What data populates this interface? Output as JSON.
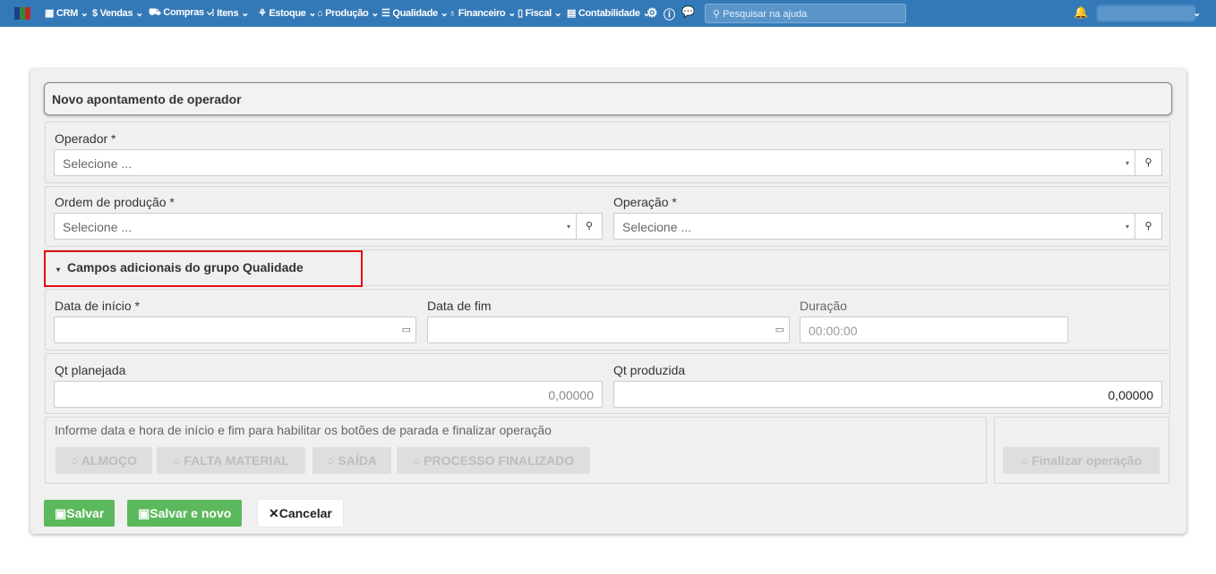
{
  "nav": {
    "items": [
      "CRM",
      "Vendas",
      "Compras",
      "Itens",
      "Estoque",
      "Produção",
      "Qualidade",
      "Financeiro",
      "Fiscal",
      "Contabilidade"
    ],
    "search_placeholder": "Pesquisar na ajuda",
    "brand_colors": [
      "#1c3e8c",
      "#2e8b3a",
      "#c0272d",
      "#e3a21a"
    ]
  },
  "form": {
    "title": "Novo apontamento de operador",
    "operador": {
      "label": "Operador *",
      "placeholder": "Selecione ..."
    },
    "ordem": {
      "label": "Ordem de produção *",
      "placeholder": "Selecione ..."
    },
    "operacao": {
      "label": "Operação *",
      "placeholder": "Selecione ..."
    },
    "extra_section": "Campos adicionais do grupo Qualidade",
    "data_inicio": {
      "label": "Data de início *",
      "value": ""
    },
    "data_fim": {
      "label": "Data de fim",
      "value": ""
    },
    "duracao": {
      "label": "Duração",
      "placeholder": "00:00:00"
    },
    "qt_planejada": {
      "label": "Qt planejada",
      "value": "0,00000"
    },
    "qt_produzida": {
      "label": "Qt produzida",
      "value": "0,00000"
    },
    "info": "Informe data e hora de início e fim para habilitar os botões de parada e finalizar operação",
    "stop_buttons": [
      "ALMOÇO",
      "FALTA MATERIAL",
      "SAÍDA",
      "PROCESSO FINALIZADO"
    ],
    "finalizar": "Finalizar operação",
    "save": "Salvar",
    "save_new": "Salvar e novo",
    "cancel": "Cancelar"
  },
  "highlight_color": "#e01010"
}
